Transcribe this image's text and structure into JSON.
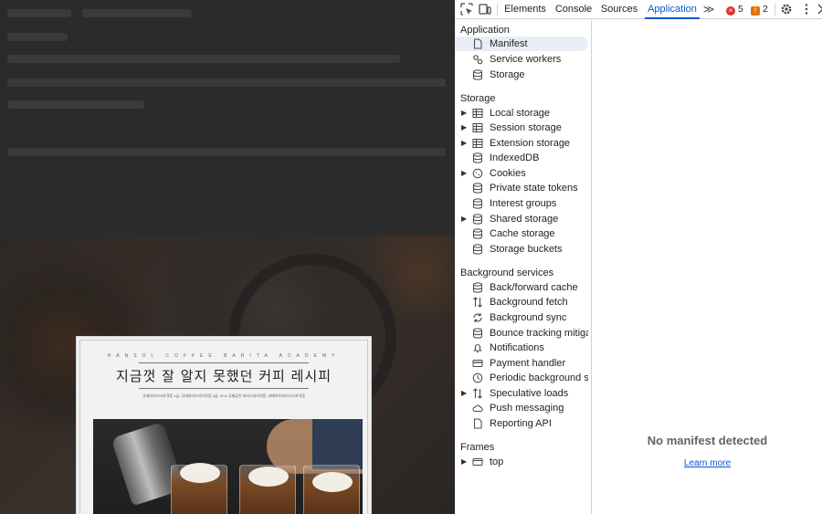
{
  "webpage": {
    "recipe_card": {
      "academy_line": "HANSOL COFFEE BARITA ACADEMY",
      "title": "지금껏 잘 알지 못했던 커피 레시피",
      "subtitle": "국내바리스타자격증 1급, 국내바리스타자격증 2급, SCA 국제공인 바리스타자격증, 라떼아트바리스타자격증"
    }
  },
  "devtools": {
    "toolbar": {
      "inspect_icon": "inspect-element-icon",
      "device_icon": "device-toolbar-icon",
      "tabs": [
        {
          "label": "Elements"
        },
        {
          "label": "Console"
        },
        {
          "label": "Sources"
        },
        {
          "label": "Application"
        }
      ],
      "more_tabs_label": "≫",
      "errors_count": "5",
      "issues_count": "2",
      "error_color": "#dc362e",
      "issue_color": "#e8710a",
      "accent_color": "#0b57d0"
    },
    "sidebar": {
      "application": {
        "title": "Application",
        "items": [
          {
            "label": "Manifest",
            "icon": "document-icon",
            "selected": true
          },
          {
            "label": "Service workers",
            "icon": "gears-icon"
          },
          {
            "label": "Storage",
            "icon": "database-icon"
          }
        ]
      },
      "storage": {
        "title": "Storage",
        "items": [
          {
            "label": "Local storage",
            "icon": "table-icon",
            "expandable": true
          },
          {
            "label": "Session storage",
            "icon": "table-icon",
            "expandable": true
          },
          {
            "label": "Extension storage",
            "icon": "table-icon",
            "expandable": true
          },
          {
            "label": "IndexedDB",
            "icon": "database-icon"
          },
          {
            "label": "Cookies",
            "icon": "cookie-icon",
            "expandable": true
          },
          {
            "label": "Private state tokens",
            "icon": "database-icon"
          },
          {
            "label": "Interest groups",
            "icon": "database-icon"
          },
          {
            "label": "Shared storage",
            "icon": "database-icon",
            "expandable": true
          },
          {
            "label": "Cache storage",
            "icon": "database-icon"
          },
          {
            "label": "Storage buckets",
            "icon": "database-icon"
          }
        ]
      },
      "background_services": {
        "title": "Background services",
        "items": [
          {
            "label": "Back/forward cache",
            "icon": "database-icon"
          },
          {
            "label": "Background fetch",
            "icon": "arrows-updown-icon"
          },
          {
            "label": "Background sync",
            "icon": "sync-icon"
          },
          {
            "label": "Bounce tracking mitiga...",
            "icon": "database-icon"
          },
          {
            "label": "Notifications",
            "icon": "bell-icon"
          },
          {
            "label": "Payment handler",
            "icon": "credit-card-icon"
          },
          {
            "label": "Periodic background s...",
            "icon": "clock-icon"
          },
          {
            "label": "Speculative loads",
            "icon": "arrows-updown-icon",
            "expandable": true
          },
          {
            "label": "Push messaging",
            "icon": "cloud-icon"
          },
          {
            "label": "Reporting API",
            "icon": "document-icon"
          }
        ]
      },
      "frames": {
        "title": "Frames",
        "items": [
          {
            "label": "top",
            "icon": "frame-icon",
            "expandable": true
          }
        ]
      }
    },
    "main": {
      "empty_message": "No manifest detected",
      "learn_more": "Learn more"
    }
  }
}
